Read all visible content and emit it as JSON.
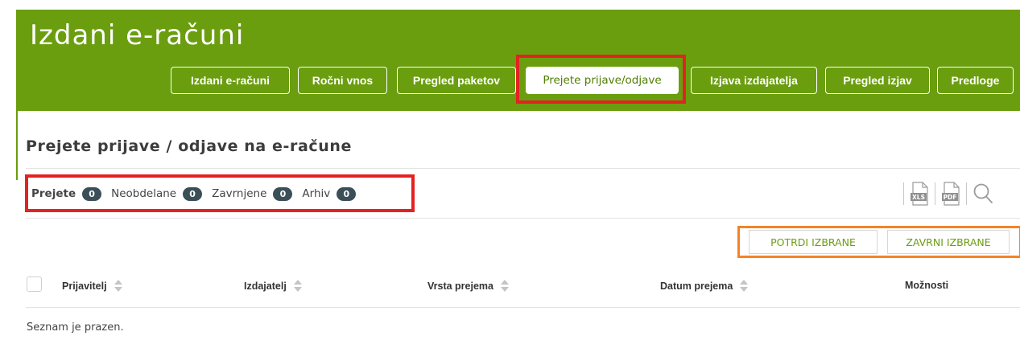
{
  "header": {
    "title": "Izdani e-računi",
    "tabs": [
      {
        "label": "Izdani e-računi"
      },
      {
        "label": "Ročni vnos"
      },
      {
        "label": "Pregled paketov"
      },
      {
        "label": "Prejete prijave/odjave"
      },
      {
        "label": "Izjava izdajatelja"
      },
      {
        "label": "Pregled izjav"
      },
      {
        "label": "Predloge"
      }
    ],
    "active_tab": "Prejete prijave/odjave"
  },
  "page": {
    "title": "Prejete prijave / odjave na e-račune"
  },
  "filters": [
    {
      "label": "Prejete",
      "count": "0"
    },
    {
      "label": "Neobdelane",
      "count": "0"
    },
    {
      "label": "Zavrnjene",
      "count": "0"
    },
    {
      "label": "Arhiv",
      "count": "0"
    }
  ],
  "tools": {
    "xls_label": "XLS",
    "pdf_label": "PDF",
    "icons": [
      "xls-export-icon",
      "pdf-export-icon",
      "search-icon"
    ]
  },
  "actions": {
    "confirm_label": "POTRDI IZBRANE",
    "reject_label": "ZAVRNI IZBRANE"
  },
  "table": {
    "columns": [
      "Prijavitelj",
      "Izdajatelj",
      "Vrsta prejema",
      "Datum prejema",
      "Možnosti"
    ],
    "empty_message": "Seznam je prazen."
  },
  "colors": {
    "header_green": "#6a9e0f",
    "badge": "#3b4f58",
    "highlight_red": "#e32222",
    "highlight_orange": "#f58325"
  }
}
